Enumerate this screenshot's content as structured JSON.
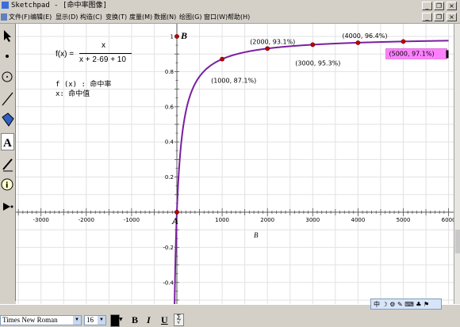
{
  "window": {
    "title": "Sketchpad - [命中率图像]",
    "controls": {
      "minimize": "_",
      "restore": "❐",
      "close": "×"
    }
  },
  "menu": [
    "文件(F)",
    "编辑(E)",
    "显示(D)",
    "构造(C)",
    "变换(T)",
    "度量(M)",
    "数据(N)",
    "绘图(G)",
    "窗口(W)",
    "帮助(H)"
  ],
  "tools": [
    "arrow-select-icon",
    "point-icon",
    "compass-icon",
    "straightedge-icon",
    "polygon-icon",
    "text-icon",
    "marker-icon",
    "information-icon",
    "custom-tool-icon"
  ],
  "formula": {
    "lhs": "f(x) =",
    "numerator": "x",
    "denominator": "x + 2·69 + 10"
  },
  "notes": {
    "line1": "f (x) : 命中率",
    "line2": "x: 命中值"
  },
  "point_labels": {
    "origin": "A",
    "y_axis_point": "B",
    "caption": "B"
  },
  "chart_data": {
    "type": "line",
    "function": "f(x) = x/(x + 2·69 + 10)",
    "xlim": [
      -3500,
      6000
    ],
    "ylim": [
      -0.5,
      1.05
    ],
    "x_ticks": [
      -3000,
      -2000,
      -1000,
      1000,
      2000,
      3000,
      4000,
      5000,
      6000
    ],
    "y_ticks": [
      -0.4,
      -0.2,
      0.2,
      0.4,
      0.6,
      0.8,
      1
    ],
    "grid": true,
    "points": [
      {
        "x": 0,
        "y": 0
      },
      {
        "x": 1000,
        "y": 0.871
      },
      {
        "x": 2000,
        "y": 0.931
      },
      {
        "x": 3000,
        "y": 0.953
      },
      {
        "x": 4000,
        "y": 0.964
      },
      {
        "x": 5000,
        "y": 0.971
      }
    ],
    "labels": [
      "(1000, 87.1%)",
      "(2000, 93.1%)",
      "(3000, 95.3%)",
      "(4000, 96.4%)",
      "(5000, 97.1%)"
    ],
    "highlighted_label_index": 4,
    "curve_color": "#7a1fa0",
    "point_color": "#c00000",
    "highlight_color": "#ff80ff"
  },
  "statusbar": {
    "font_value": "Times New Roman",
    "size_value": "16",
    "bold": "B",
    "italic": "I",
    "underline": "U",
    "ime_text": "中 ☽ ⚙ ✎ ⌨ ♣ ⚑"
  }
}
